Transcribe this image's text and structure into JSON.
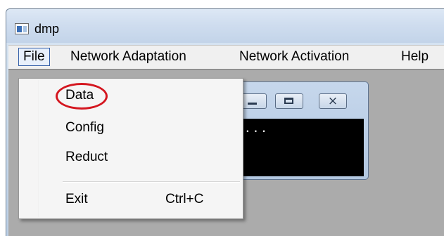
{
  "window": {
    "title": "dmp"
  },
  "menubar": {
    "items": [
      {
        "label": "File"
      },
      {
        "label": "Network Adaptation"
      },
      {
        "label": "Network Activation"
      },
      {
        "label": "Help"
      }
    ]
  },
  "file_menu": {
    "items": [
      {
        "label": "Data",
        "highlighted": true
      },
      {
        "label": "Config"
      },
      {
        "label": "Reduct"
      },
      {
        "label": "Exit",
        "shortcut": "Ctrl+C"
      }
    ]
  },
  "child_window": {
    "buttons": [
      "minimize-icon",
      "maximize-icon",
      "close-icon"
    ],
    "console_text": "..."
  },
  "colors": {
    "highlight_ring": "#d4161f",
    "menu_active_border": "#335ea8",
    "client_background": "#ababab",
    "console_background": "#000000"
  }
}
